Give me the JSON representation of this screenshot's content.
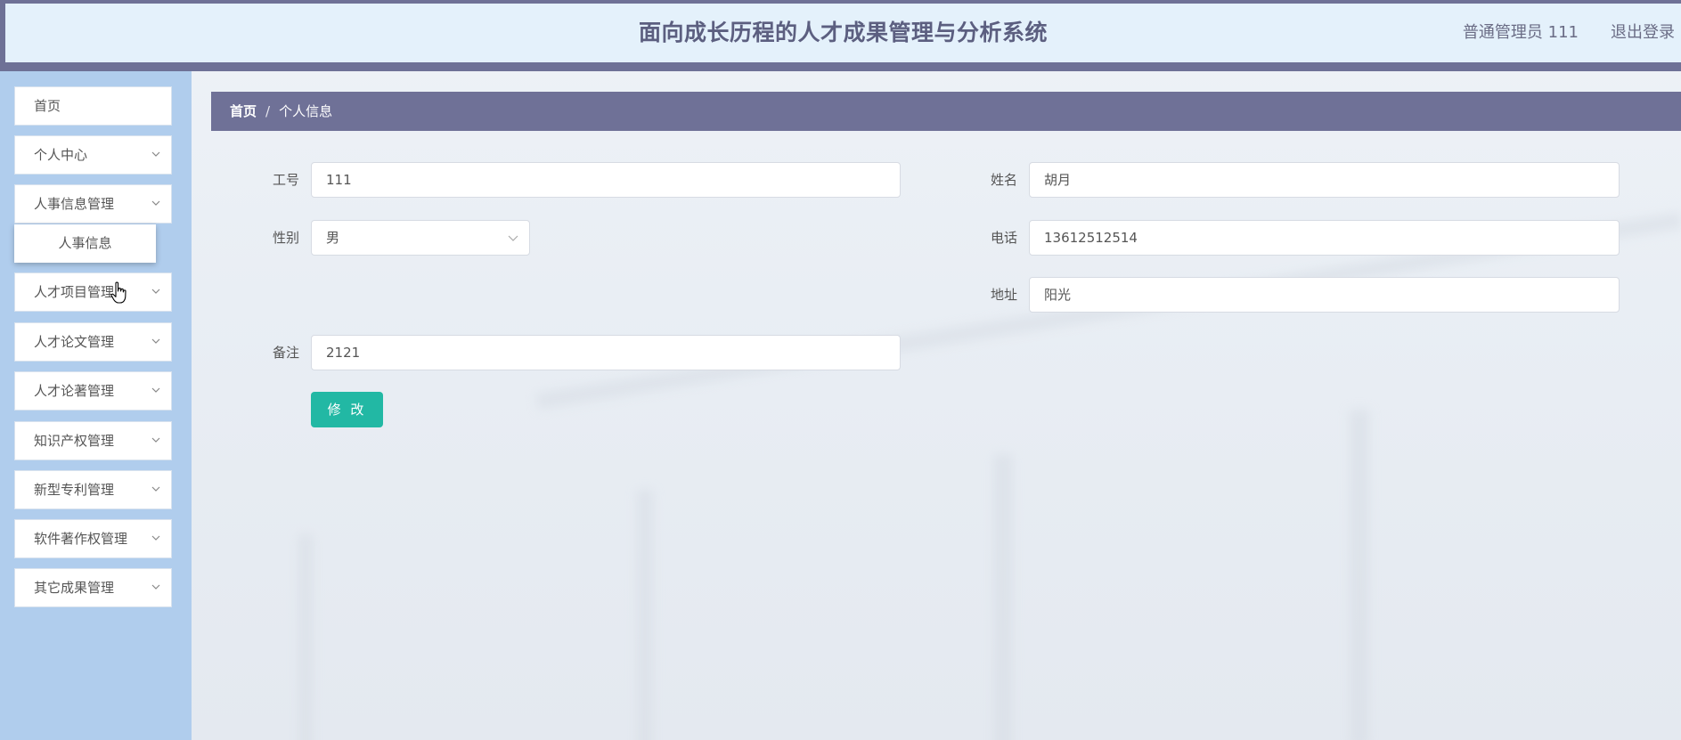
{
  "header": {
    "title": "面向成长历程的人才成果管理与分析系统",
    "user": "普通管理员 111",
    "logout": "退出登录"
  },
  "sidebar": {
    "items": [
      {
        "label": "首页",
        "has_chevron": false
      },
      {
        "label": "个人中心",
        "has_chevron": true
      },
      {
        "label": "人事信息管理",
        "has_chevron": true
      },
      {
        "label": "人才项目管理",
        "has_chevron": true
      },
      {
        "label": "人才论文管理",
        "has_chevron": true
      },
      {
        "label": "人才论著管理",
        "has_chevron": true
      },
      {
        "label": "知识产权管理",
        "has_chevron": true
      },
      {
        "label": "新型专利管理",
        "has_chevron": true
      },
      {
        "label": "软件著作权管理",
        "has_chevron": true
      },
      {
        "label": "其它成果管理",
        "has_chevron": true
      }
    ],
    "submenu": {
      "label": "人事信息"
    }
  },
  "breadcrumb": {
    "home": "首页",
    "separator": "/",
    "current": "个人信息"
  },
  "form": {
    "job_no": {
      "label": "工号",
      "value": "111"
    },
    "name": {
      "label": "姓名",
      "value": "胡月"
    },
    "gender": {
      "label": "性别",
      "value": "男"
    },
    "phone": {
      "label": "电话",
      "value": "13612512514"
    },
    "address": {
      "label": "地址",
      "value": "阳光"
    },
    "remark": {
      "label": "备注",
      "value": "2121"
    },
    "submit_label": "修 改"
  },
  "colors": {
    "header_band": "#6e7196",
    "header_bg": "#e4f1fb",
    "sidebar_bg": "#b0cded",
    "breadcrumb_bg": "#6f7197",
    "button_bg": "#22b8a4"
  },
  "icons": {
    "chevron": "chevron-down-icon",
    "cursor": "hand-cursor-icon"
  }
}
